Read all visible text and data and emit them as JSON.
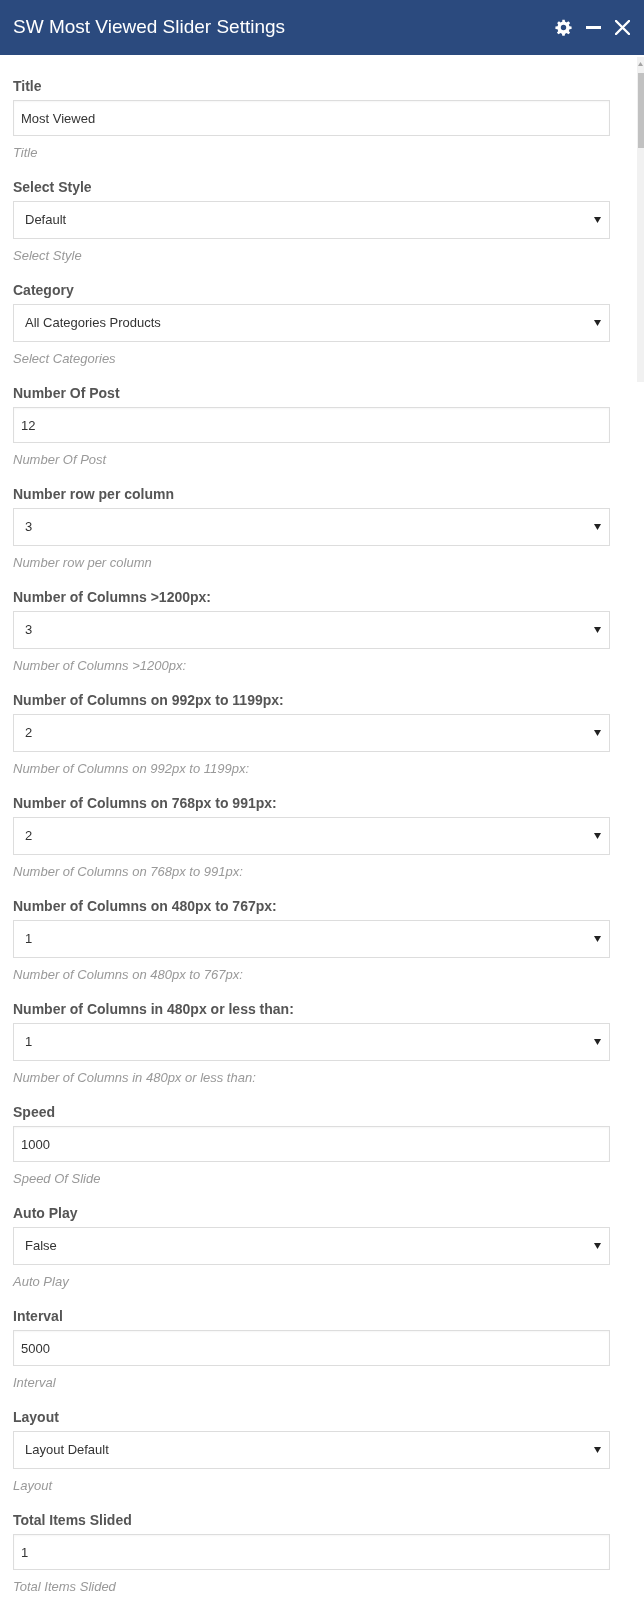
{
  "window": {
    "title": "SW Most Viewed Slider Settings"
  },
  "fields": [
    {
      "kind": "text",
      "label": "Title",
      "value": "Most Viewed",
      "hint": "Title"
    },
    {
      "kind": "select",
      "label": "Select Style",
      "value": "Default",
      "hint": "Select Style"
    },
    {
      "kind": "select",
      "label": "Category",
      "value": "All Categories Products",
      "hint": "Select Categories"
    },
    {
      "kind": "text",
      "label": "Number Of Post",
      "value": "12",
      "hint": "Number Of Post"
    },
    {
      "kind": "select",
      "label": "Number row per column",
      "value": "3",
      "hint": "Number row per column"
    },
    {
      "kind": "select",
      "label": "Number of Columns >1200px:",
      "value": "3",
      "hint": "Number of Columns >1200px:"
    },
    {
      "kind": "select",
      "label": "Number of Columns on 992px to 1199px:",
      "value": "2",
      "hint": "Number of Columns on 992px to 1199px:"
    },
    {
      "kind": "select",
      "label": "Number of Columns on 768px to 991px:",
      "value": "2",
      "hint": "Number of Columns on 768px to 991px:"
    },
    {
      "kind": "select",
      "label": "Number of Columns on 480px to 767px:",
      "value": "1",
      "hint": "Number of Columns on 480px to 767px:"
    },
    {
      "kind": "select",
      "label": "Number of Columns in 480px or less than:",
      "value": "1",
      "hint": "Number of Columns in 480px or less than:"
    },
    {
      "kind": "text",
      "label": "Speed",
      "value": "1000",
      "hint": "Speed Of Slide"
    },
    {
      "kind": "select",
      "label": "Auto Play",
      "value": "False",
      "hint": "Auto Play"
    },
    {
      "kind": "text",
      "label": "Interval",
      "value": "5000",
      "hint": "Interval"
    },
    {
      "kind": "select",
      "label": "Layout",
      "value": "Layout Default",
      "hint": "Layout"
    },
    {
      "kind": "text",
      "label": "Total Items Slided",
      "value": "1",
      "hint": "Total Items Slided"
    }
  ]
}
